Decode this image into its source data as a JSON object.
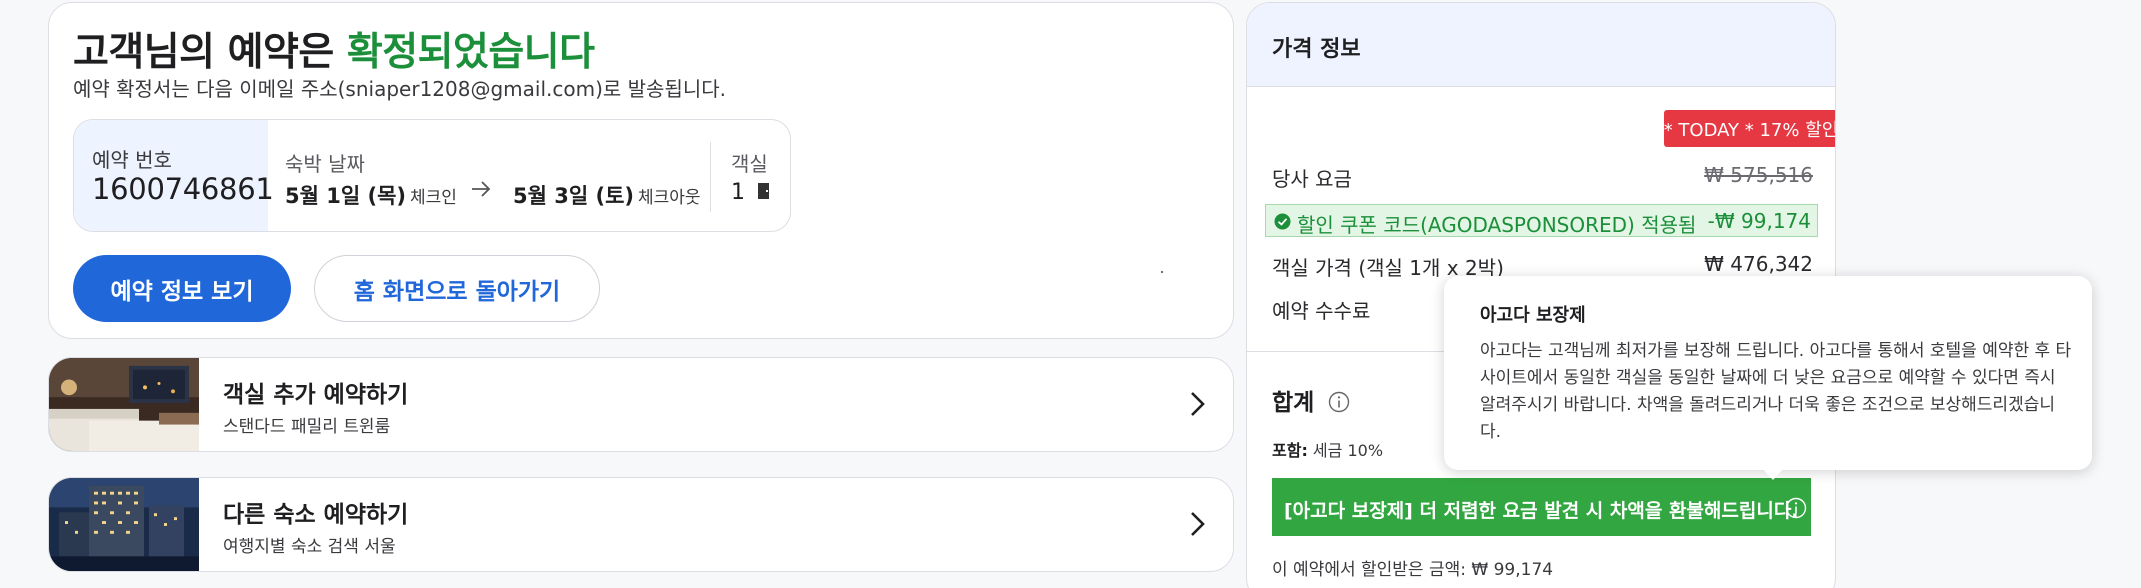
{
  "confirmation": {
    "title_prefix": "고객님의 예약은 ",
    "title_highlight": "확정되었습니다",
    "subtitle": "예약 확정서는 다음 이메일 주소(sniaper1208@gmail.com)로 발송됩니다.",
    "booking_number_label": "예약 번호",
    "booking_number": "1600746861",
    "stay_date_label": "숙박 날짜",
    "checkin_date": "5월 1일 (목)",
    "checkin_label": "체크인",
    "checkout_date": "5월 3일 (토)",
    "checkout_label": "체크아웃",
    "rooms_label": "객실",
    "rooms_value": "1",
    "view_booking_button": "예약 정보 보기",
    "home_button": "홈 화면으로 돌아가기"
  },
  "upsells": [
    {
      "title": "객실 추가 예약하기",
      "subtitle": "스탠다드 패밀리 트윈룸"
    },
    {
      "title": "다른 숙소 예약하기",
      "subtitle": "여행지별 숙소 검색 서울"
    }
  ],
  "price_panel": {
    "header": "가격 정보",
    "promo_badge": "* TODAY * 17% 할인",
    "our_rate_label": "당사 요금",
    "our_rate_value": "₩ 575,516",
    "coupon_label": "할인 쿠폰 코드(AGODASPONSORED) 적용됨",
    "coupon_value": "-₩ 99,174",
    "room_price_label": "객실 가격 (객실 1개 x 2박)",
    "room_price_value": "₩ 476,342",
    "booking_fee_label": "예약 수수료",
    "total_label": "합계",
    "includes_label": "포함:",
    "includes_value": " 세금 10%",
    "guarantee_bracket": "[아고다 보장제]",
    "guarantee_text": " 더 저렴한 요금 발견 시 차액을 환불해드립니다.",
    "saved_label": "이 예약에서 할인받은 금액:",
    "saved_value": " ₩ 99,174"
  },
  "tooltip": {
    "title": "아고다 보장제",
    "body": "아고다는 고객님께 최저가를 보장해 드립니다. 아고다를 통해서 호텔을 예약한 후 타 사이트에서 동일한 객실을 동일한 날짜에 더 낮은 요금으로 예약할 수 있다면 즉시 알려주시기 바랍니다. 차액을 돌려드리거나 더욱 좋은 조건으로 보상해드리겠습니다."
  },
  "colors": {
    "primary": "#2067da",
    "success": "#1b8f3a",
    "guarantee_bar": "#32a640",
    "promo_badge": "#e53842",
    "header_bg": "#eef3ff"
  },
  "icons": [
    "arrow-right-icon",
    "door-icon",
    "chevron-right-icon",
    "check-circle-icon",
    "info-icon"
  ]
}
